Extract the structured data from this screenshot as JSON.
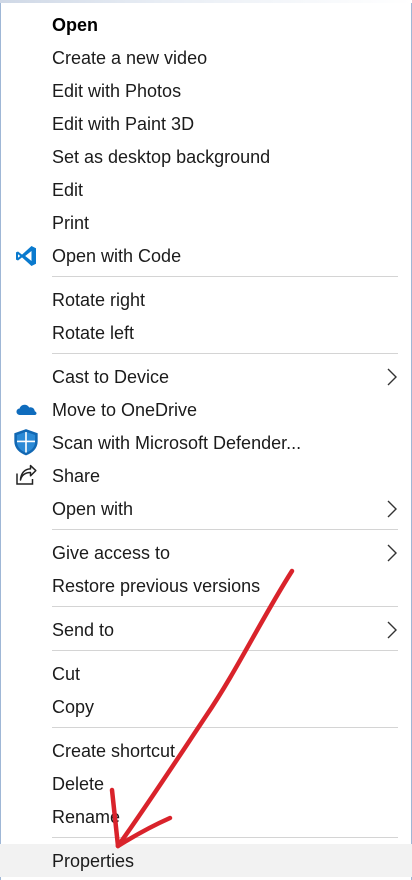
{
  "context_menu": {
    "items": [
      {
        "label": "Open"
      },
      {
        "label": "Create a new video"
      },
      {
        "label": "Edit with Photos"
      },
      {
        "label": "Edit with Paint 3D"
      },
      {
        "label": "Set as desktop background"
      },
      {
        "label": "Edit"
      },
      {
        "label": "Print"
      },
      {
        "label": "Open with Code",
        "icon": "vscode-icon"
      },
      {
        "label": "Rotate right"
      },
      {
        "label": "Rotate left"
      },
      {
        "label": "Cast to Device",
        "submenu": true
      },
      {
        "label": "Move to OneDrive",
        "icon": "onedrive-cloud-icon"
      },
      {
        "label": "Scan with Microsoft Defender...",
        "icon": "defender-shield-icon"
      },
      {
        "label": "Share",
        "icon": "share-icon"
      },
      {
        "label": "Open with",
        "submenu": true
      },
      {
        "label": "Give access to",
        "submenu": true
      },
      {
        "label": "Restore previous versions"
      },
      {
        "label": "Send to",
        "submenu": true
      },
      {
        "label": "Cut"
      },
      {
        "label": "Copy"
      },
      {
        "label": "Create shortcut"
      },
      {
        "label": "Delete"
      },
      {
        "label": "Rename"
      },
      {
        "label": "Properties",
        "highlighted": true
      }
    ]
  },
  "annotation": {
    "type": "arrow",
    "color": "#d9232b",
    "points_to": "Properties"
  },
  "colors": {
    "vscode_blue": "#0a7ace",
    "onedrive_blue": "#0f6cbd",
    "defender_blue": "#1268b3",
    "separator": "#d4d4d4",
    "menu_border": "#9fb7d6"
  }
}
